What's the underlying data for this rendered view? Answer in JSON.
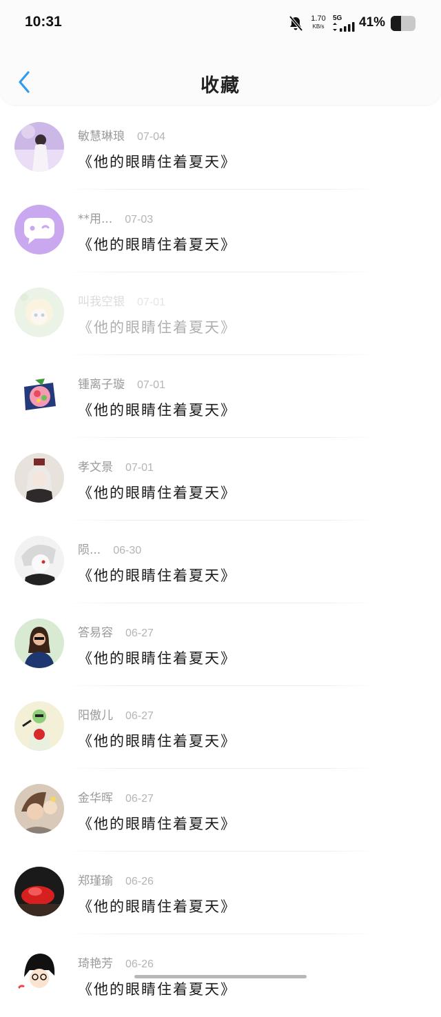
{
  "status": {
    "time": "10:31",
    "net_speed": "1.70",
    "net_unit": "KB/s",
    "network": "5G",
    "battery_pct": "41%",
    "battery_level": 0.41
  },
  "header": {
    "title": "收藏",
    "back_icon": "chevron-left-icon"
  },
  "colors": {
    "accent": "#2f9bef",
    "text": "#1a1a1a",
    "meta": "#9a9a9a"
  },
  "items": [
    {
      "name": "敏慧琳琅",
      "date": "07-04",
      "work": "《他的眼睛住着夏天》"
    },
    {
      "name": "**用...",
      "date": "07-03",
      "work": "《他的眼睛住着夏天》"
    },
    {
      "name": "叫我空银",
      "date": "07-01",
      "work": "《他的眼睛住着夏天》"
    },
    {
      "name": "锺离子璇",
      "date": "07-01",
      "work": "《他的眼睛住着夏天》"
    },
    {
      "name": "孝文景",
      "date": "07-01",
      "work": "《他的眼睛住着夏天》"
    },
    {
      "name": "陨...",
      "date": "06-30",
      "work": "《他的眼睛住着夏天》"
    },
    {
      "name": "答易容",
      "date": "06-27",
      "work": "《他的眼睛住着夏天》"
    },
    {
      "name": "阳傲儿",
      "date": "06-27",
      "work": "《他的眼睛住着夏天》"
    },
    {
      "name": "金华晖",
      "date": "06-27",
      "work": "《他的眼睛住着夏天》"
    },
    {
      "name": "郑瑾瑜",
      "date": "06-26",
      "work": "《他的眼睛住着夏天》"
    },
    {
      "name": "琦艳芳",
      "date": "06-26",
      "work": "《他的眼睛住着夏天》"
    }
  ]
}
